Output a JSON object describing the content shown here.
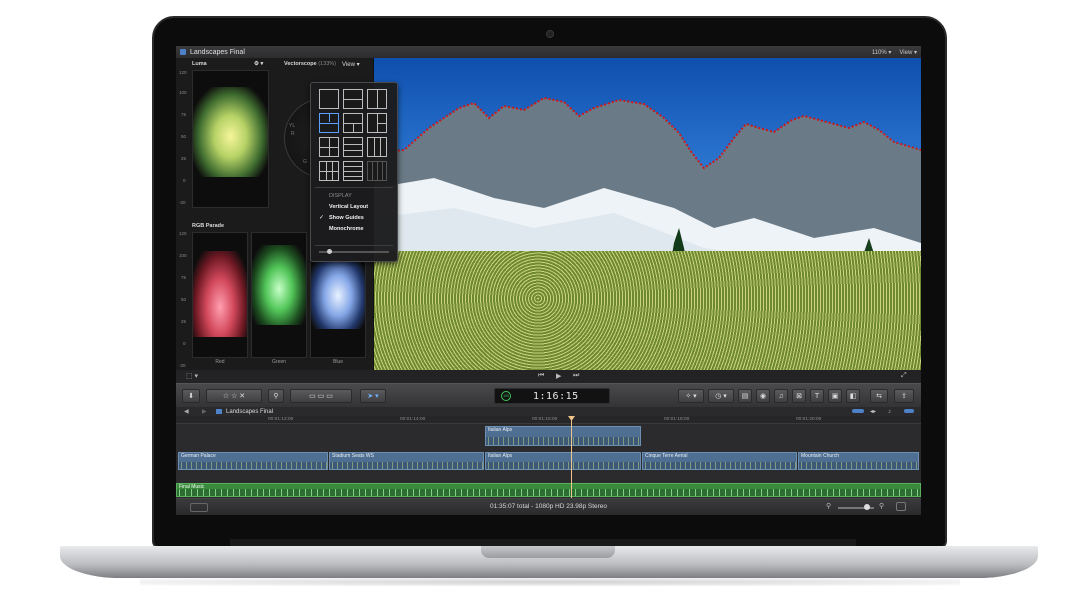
{
  "window": {
    "title": "Landscapes Final",
    "zoom": "110%",
    "view_menu": "View"
  },
  "scopes": {
    "luma": {
      "label": "Luma",
      "scale": [
        "120",
        "100",
        "75",
        "50",
        "25",
        "0",
        "-20"
      ]
    },
    "vectorscope": {
      "label": "Vectorscope",
      "zoom": "(133%)",
      "marks": [
        "YL",
        "R",
        "G"
      ]
    },
    "rgb_parade": {
      "label": "RGB Parade",
      "scale": [
        "120",
        "100",
        "75",
        "50",
        "25",
        "0",
        "-20"
      ],
      "channels": [
        "Red",
        "Green",
        "Blue"
      ]
    }
  },
  "view_popover": {
    "header": "View",
    "display_heading": "DISPLAY",
    "items": [
      {
        "label": "Vertical Layout",
        "checked": false
      },
      {
        "label": "Show Guides",
        "checked": true
      },
      {
        "label": "Monochrome",
        "checked": false
      }
    ]
  },
  "toolbar": {
    "timecode": "1:16:15",
    "timecode_ring": "100"
  },
  "timeline": {
    "project": "Landscapes Final",
    "ruler": [
      "00:01:12:00",
      "00:01:14:00",
      "00:01:16:00",
      "00:01:18:00",
      "00:01:20:00"
    ],
    "connected_clips": [
      {
        "name": "Italian Alps"
      }
    ],
    "primary_clips": [
      {
        "name": "German Palace"
      },
      {
        "name": "Stadium Seats WS"
      },
      {
        "name": "Italian Alps"
      },
      {
        "name": "Cinque Terre Aerial"
      },
      {
        "name": "Mountain Church"
      }
    ],
    "music": {
      "name": "Final Music"
    }
  },
  "status": {
    "text": "01:35:07 total - 1080p HD 23.98p Stereo"
  },
  "colors": {
    "accent_blue": "#5aa0ff",
    "timecode_green": "#41c35a",
    "clip_blue": "#4f6f92",
    "music_green": "#3a8a3e",
    "playhead": "#f0c38a"
  }
}
